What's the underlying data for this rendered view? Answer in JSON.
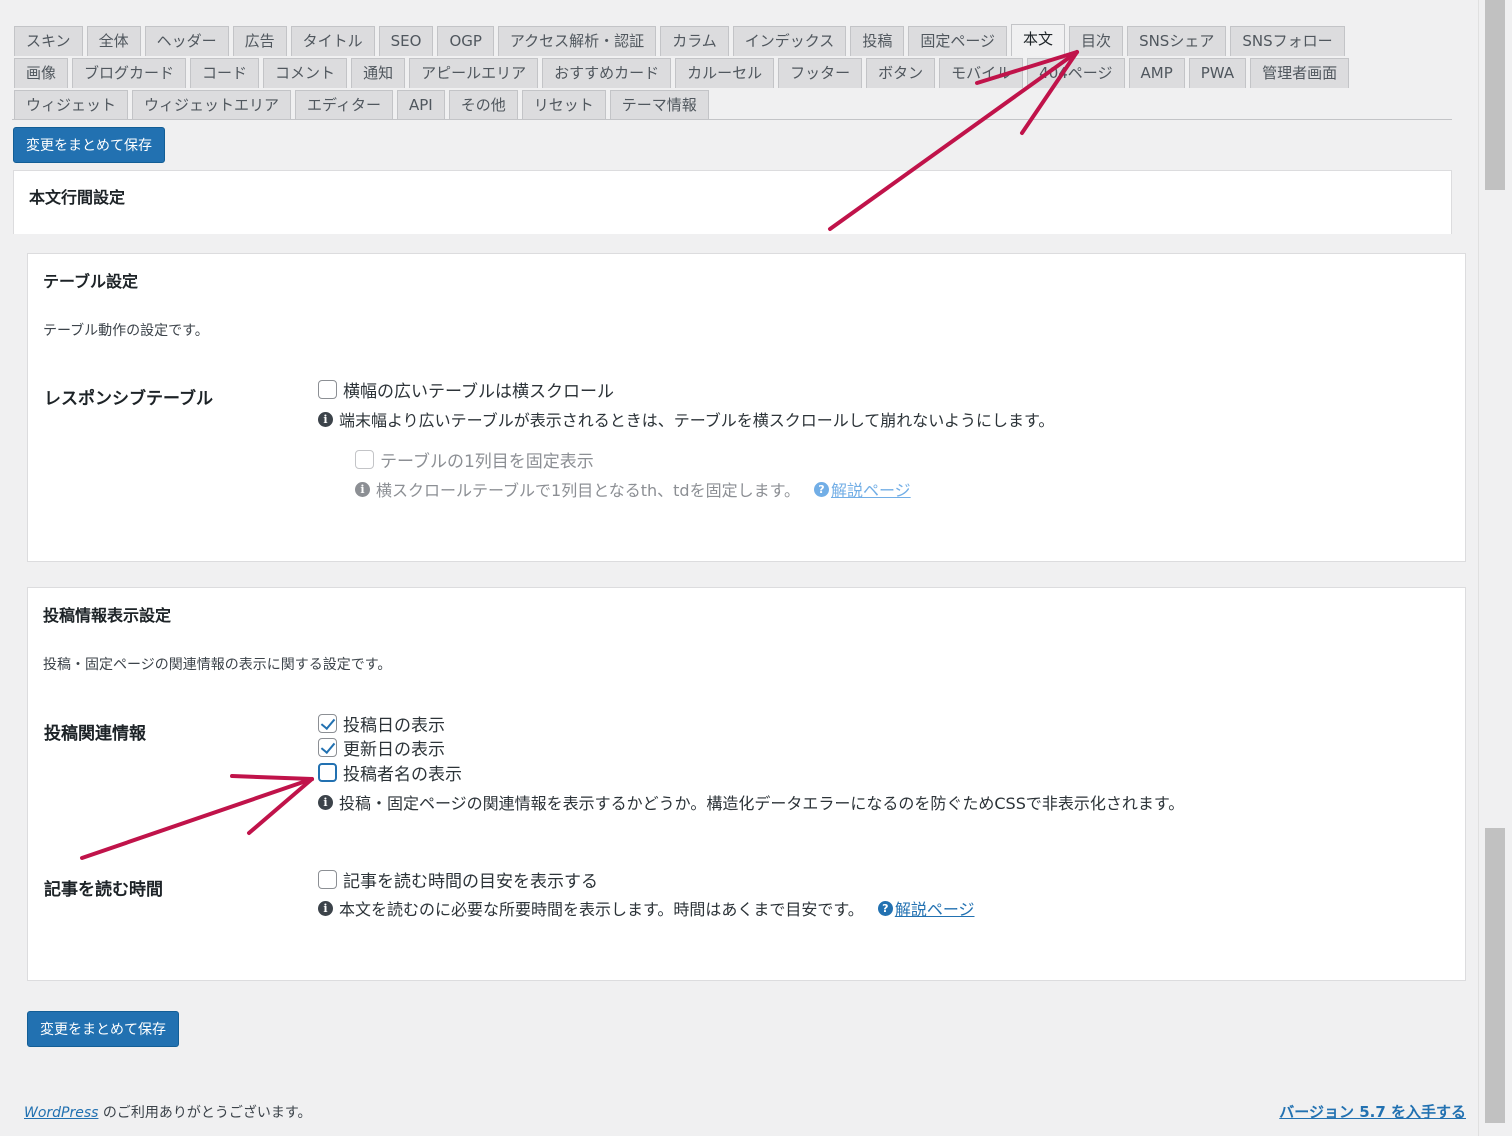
{
  "tabs": {
    "rows": [
      [
        {
          "label": "スキン"
        },
        {
          "label": "全体"
        },
        {
          "label": "ヘッダー"
        },
        {
          "label": "広告"
        },
        {
          "label": "タイトル"
        },
        {
          "label": "SEO"
        },
        {
          "label": "OGP"
        },
        {
          "label": "アクセス解析・認証"
        },
        {
          "label": "カラム"
        },
        {
          "label": "インデックス"
        },
        {
          "label": "投稿"
        },
        {
          "label": "固定ページ"
        },
        {
          "label": "本文"
        },
        {
          "label": "目次"
        },
        {
          "label": "SNSシェア"
        },
        {
          "label": "SNSフォロー"
        }
      ],
      [
        {
          "label": "画像"
        },
        {
          "label": "ブログカード"
        },
        {
          "label": "コード"
        },
        {
          "label": "コメント"
        },
        {
          "label": "通知"
        },
        {
          "label": "アピールエリア"
        },
        {
          "label": "おすすめカード"
        },
        {
          "label": "カルーセル"
        },
        {
          "label": "フッター"
        },
        {
          "label": "ボタン"
        },
        {
          "label": "モバイル"
        },
        {
          "label": "404ページ"
        },
        {
          "label": "AMP"
        },
        {
          "label": "PWA"
        },
        {
          "label": "管理者画面"
        }
      ],
      [
        {
          "label": "ウィジェット"
        },
        {
          "label": "ウィジェットエリア"
        },
        {
          "label": "エディター"
        },
        {
          "label": "API"
        },
        {
          "label": "その他"
        },
        {
          "label": "リセット"
        },
        {
          "label": "テーマ情報"
        }
      ]
    ],
    "active": "本文"
  },
  "save_label": "変更をまとめて保存",
  "line_height_panel": {
    "title": "本文行間設定"
  },
  "table_panel": {
    "title": "テーブル設定",
    "desc": "テーブル動作の設定です。",
    "responsive_label": "レスポンシブテーブル",
    "scroll_option": "横幅の広いテーブルは横スクロール",
    "scroll_note": "端末幅より広いテーブルが表示されるときは、テーブルを横スクロールして崩れないようにします。",
    "fix_option": "テーブルの1列目を固定表示",
    "fix_note": "横スクロールテーブルで1列目となるth、tdを固定します。",
    "help_link": "解説ページ"
  },
  "post_info_panel": {
    "title": "投稿情報表示設定",
    "desc": "投稿・固定ページの関連情報の表示に関する設定です。",
    "related_label": "投稿関連情報",
    "opt_post_date": "投稿日の表示",
    "opt_update_date": "更新日の表示",
    "opt_author": "投稿者名の表示",
    "related_note": "投稿・固定ページの関連情報を表示するかどうか。構造化データエラーになるのを防ぐためCSSで非表示化されます。",
    "reading_label": "記事を読む時間",
    "reading_option": "記事を読む時間の目安を表示する",
    "reading_note": "本文を読むのに必要な所要時間を表示します。時間はあくまで目安です。",
    "help_link": "解説ページ"
  },
  "footer": {
    "wordpress_link": "WordPress",
    "thanks": " のご利用ありがとうございます。",
    "version_link": "バージョン 5.7 を入手する"
  },
  "colors": {
    "primary": "#2271b1",
    "annotation_arrow": "#c0134a",
    "background": "#f0f0f1"
  }
}
